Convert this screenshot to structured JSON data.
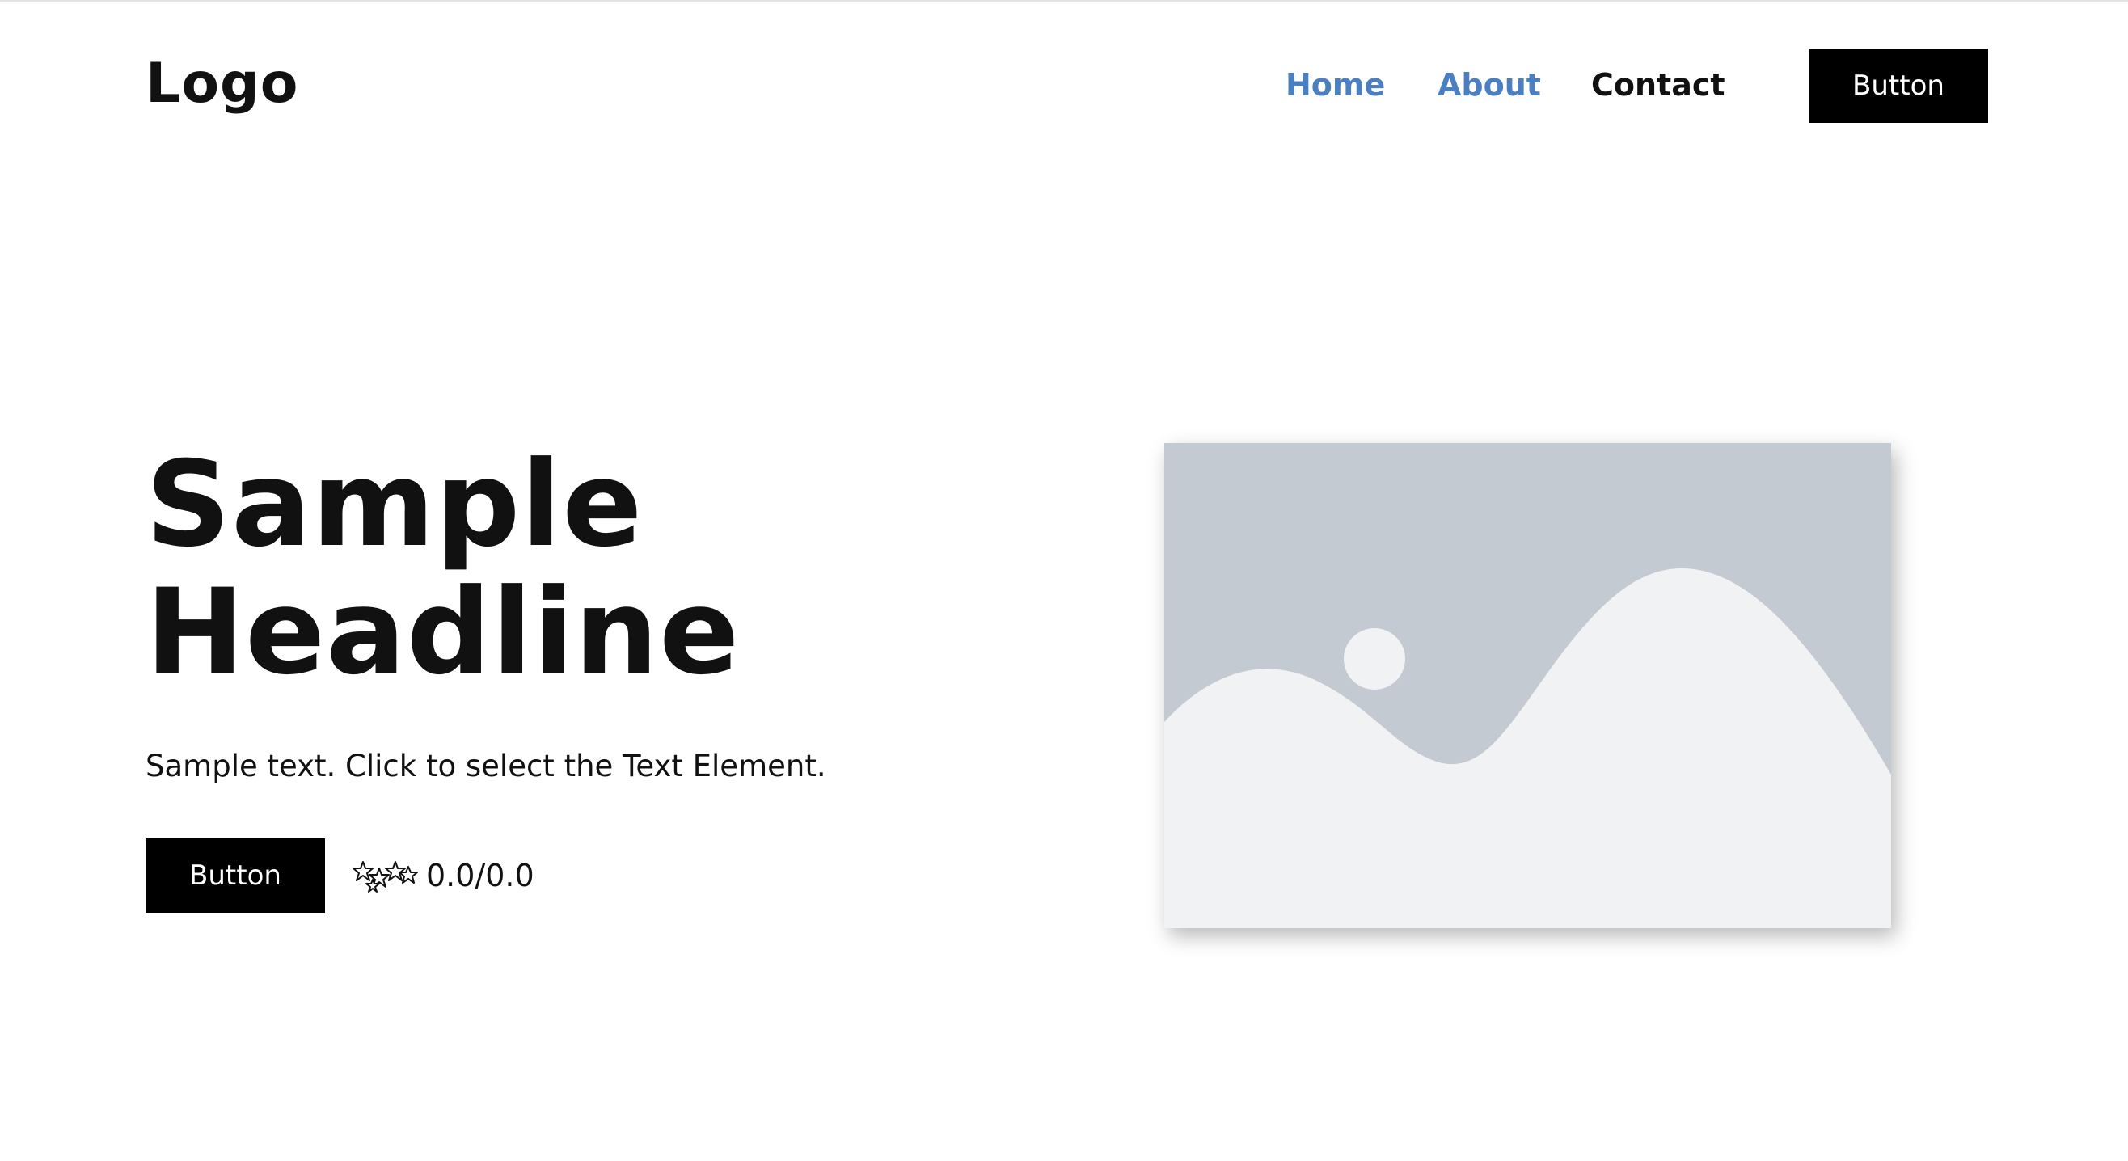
{
  "header": {
    "logo": "Logo",
    "nav": {
      "home": "Home",
      "about": "About",
      "contact": "Contact"
    },
    "button_label": "Button",
    "link_color": "#4a7fc1"
  },
  "hero": {
    "headline_line1": "Sample",
    "headline_line2": "Headline",
    "subtext": "Sample text. Click to select the Text Element.",
    "button_label": "Button",
    "rating_text": "0.0/0.0",
    "rating_icon": "stars-icon"
  },
  "image_placeholder": {
    "icon": "image-placeholder-icon",
    "background_color": "#c4cad2",
    "foreground_color": "#f1f2f4"
  }
}
